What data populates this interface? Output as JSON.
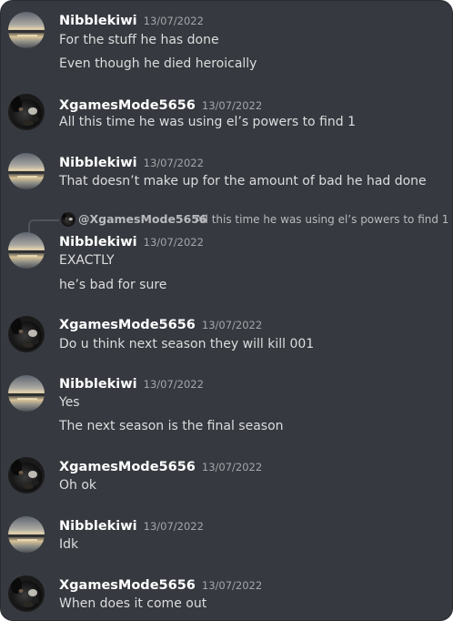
{
  "messages": [
    {
      "author": "Nibblekiwi",
      "timestamp": "13/07/2022",
      "avatar": "lake-sunset-avatar",
      "lines": [
        "For the stuff he has done",
        "Even though he died heroically"
      ]
    },
    {
      "author": "XgamesMode5656",
      "timestamp": "13/07/2022",
      "avatar": "dog-avatar",
      "lines": [
        "All this time he was using el’s powers to find 1"
      ]
    },
    {
      "author": "Nibblekiwi",
      "timestamp": "13/07/2022",
      "avatar": "lake-sunset-avatar",
      "lines": [
        "That doesn’t make up for the amount of bad he had done"
      ]
    },
    {
      "author": "Nibblekiwi",
      "timestamp": "13/07/2022",
      "avatar": "lake-sunset-avatar",
      "lines": [
        "EXACTLY",
        "he’s bad for sure"
      ]
    },
    {
      "author": "XgamesMode5656",
      "timestamp": "13/07/2022",
      "avatar": "dog-avatar",
      "lines": [
        "Do u think next season they will kill 001"
      ]
    },
    {
      "author": "Nibblekiwi",
      "timestamp": "13/07/2022",
      "avatar": "lake-sunset-avatar",
      "lines": [
        "Yes",
        "The next season is the final season"
      ]
    },
    {
      "author": "XgamesMode5656",
      "timestamp": "13/07/2022",
      "avatar": "dog-avatar",
      "lines": [
        "Oh ok"
      ]
    },
    {
      "author": "Nibblekiwi",
      "timestamp": "13/07/2022",
      "avatar": "lake-sunset-avatar",
      "lines": [
        "Idk"
      ]
    },
    {
      "author": "XgamesMode5656",
      "timestamp": "13/07/2022",
      "avatar": "dog-avatar",
      "lines": [
        "When does it come out"
      ]
    }
  ],
  "reply": {
    "mention": "@XgamesMode5656",
    "text": "All this time he was using el’s powers to find 1"
  },
  "colors": {
    "background": "#36393f",
    "author": "#ffffff",
    "message_text": "#dcddde",
    "timestamp": "#a3a6aa"
  }
}
